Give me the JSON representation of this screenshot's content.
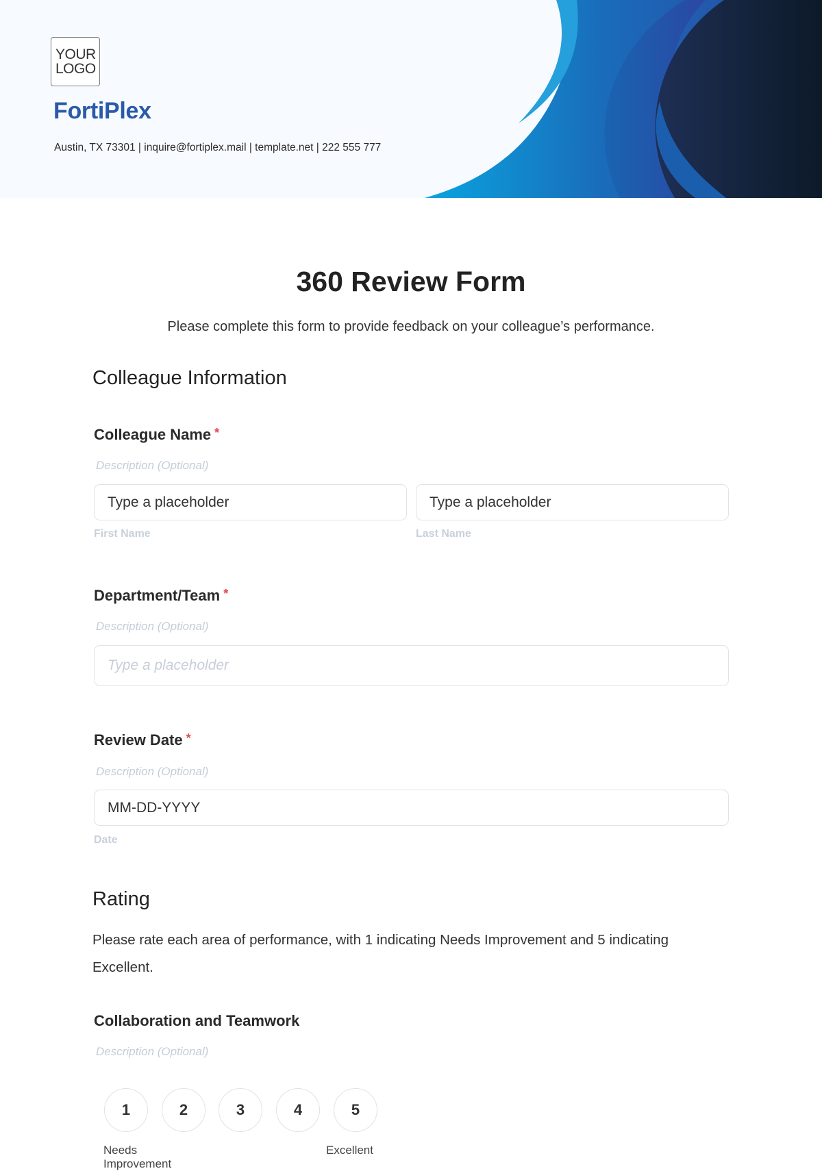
{
  "header": {
    "logo_line1": "YOUR",
    "logo_line2": "LOGO",
    "company_name": "FortiPlex",
    "contact_line": "Austin, TX 73301 | inquire@fortiplex.mail | template.net | 222 555 777",
    "colors": {
      "brand": "#2a5aa8",
      "wave_light": "#26a0dc",
      "wave_mid": "#1c64b4",
      "wave_dark": "#111f36"
    }
  },
  "form": {
    "title": "360 Review Form",
    "subtitle": "Please complete this form to provide feedback on your colleague’s performance.",
    "sections": {
      "colleague_info": {
        "heading": "Colleague Information",
        "colleague_name": {
          "label": "Colleague Name",
          "required_mark": "*",
          "description": "Description (Optional)",
          "first_name": {
            "placeholder": "Type a placeholder",
            "sublabel": "First Name"
          },
          "last_name": {
            "placeholder": "Type a placeholder",
            "sublabel": "Last Name"
          }
        },
        "department": {
          "label": "Department/Team",
          "required_mark": "*",
          "description": "Description (Optional)",
          "placeholder": "Type a placeholder"
        },
        "review_date": {
          "label": "Review Date",
          "required_mark": "*",
          "description": "Description (Optional)",
          "placeholder": "MM-DD-YYYY",
          "sublabel": "Date"
        }
      },
      "rating": {
        "heading": "Rating",
        "instructions": "Please rate each area of performance, with 1 indicating Needs Improvement and 5 indicating Excellent.",
        "items": [
          {
            "label": "Collaboration and Teamwork",
            "description": "Description (Optional)",
            "options": [
              "1",
              "2",
              "3",
              "4",
              "5"
            ],
            "low_label": "Needs Improvement",
            "high_label": "Excellent"
          }
        ]
      }
    }
  }
}
